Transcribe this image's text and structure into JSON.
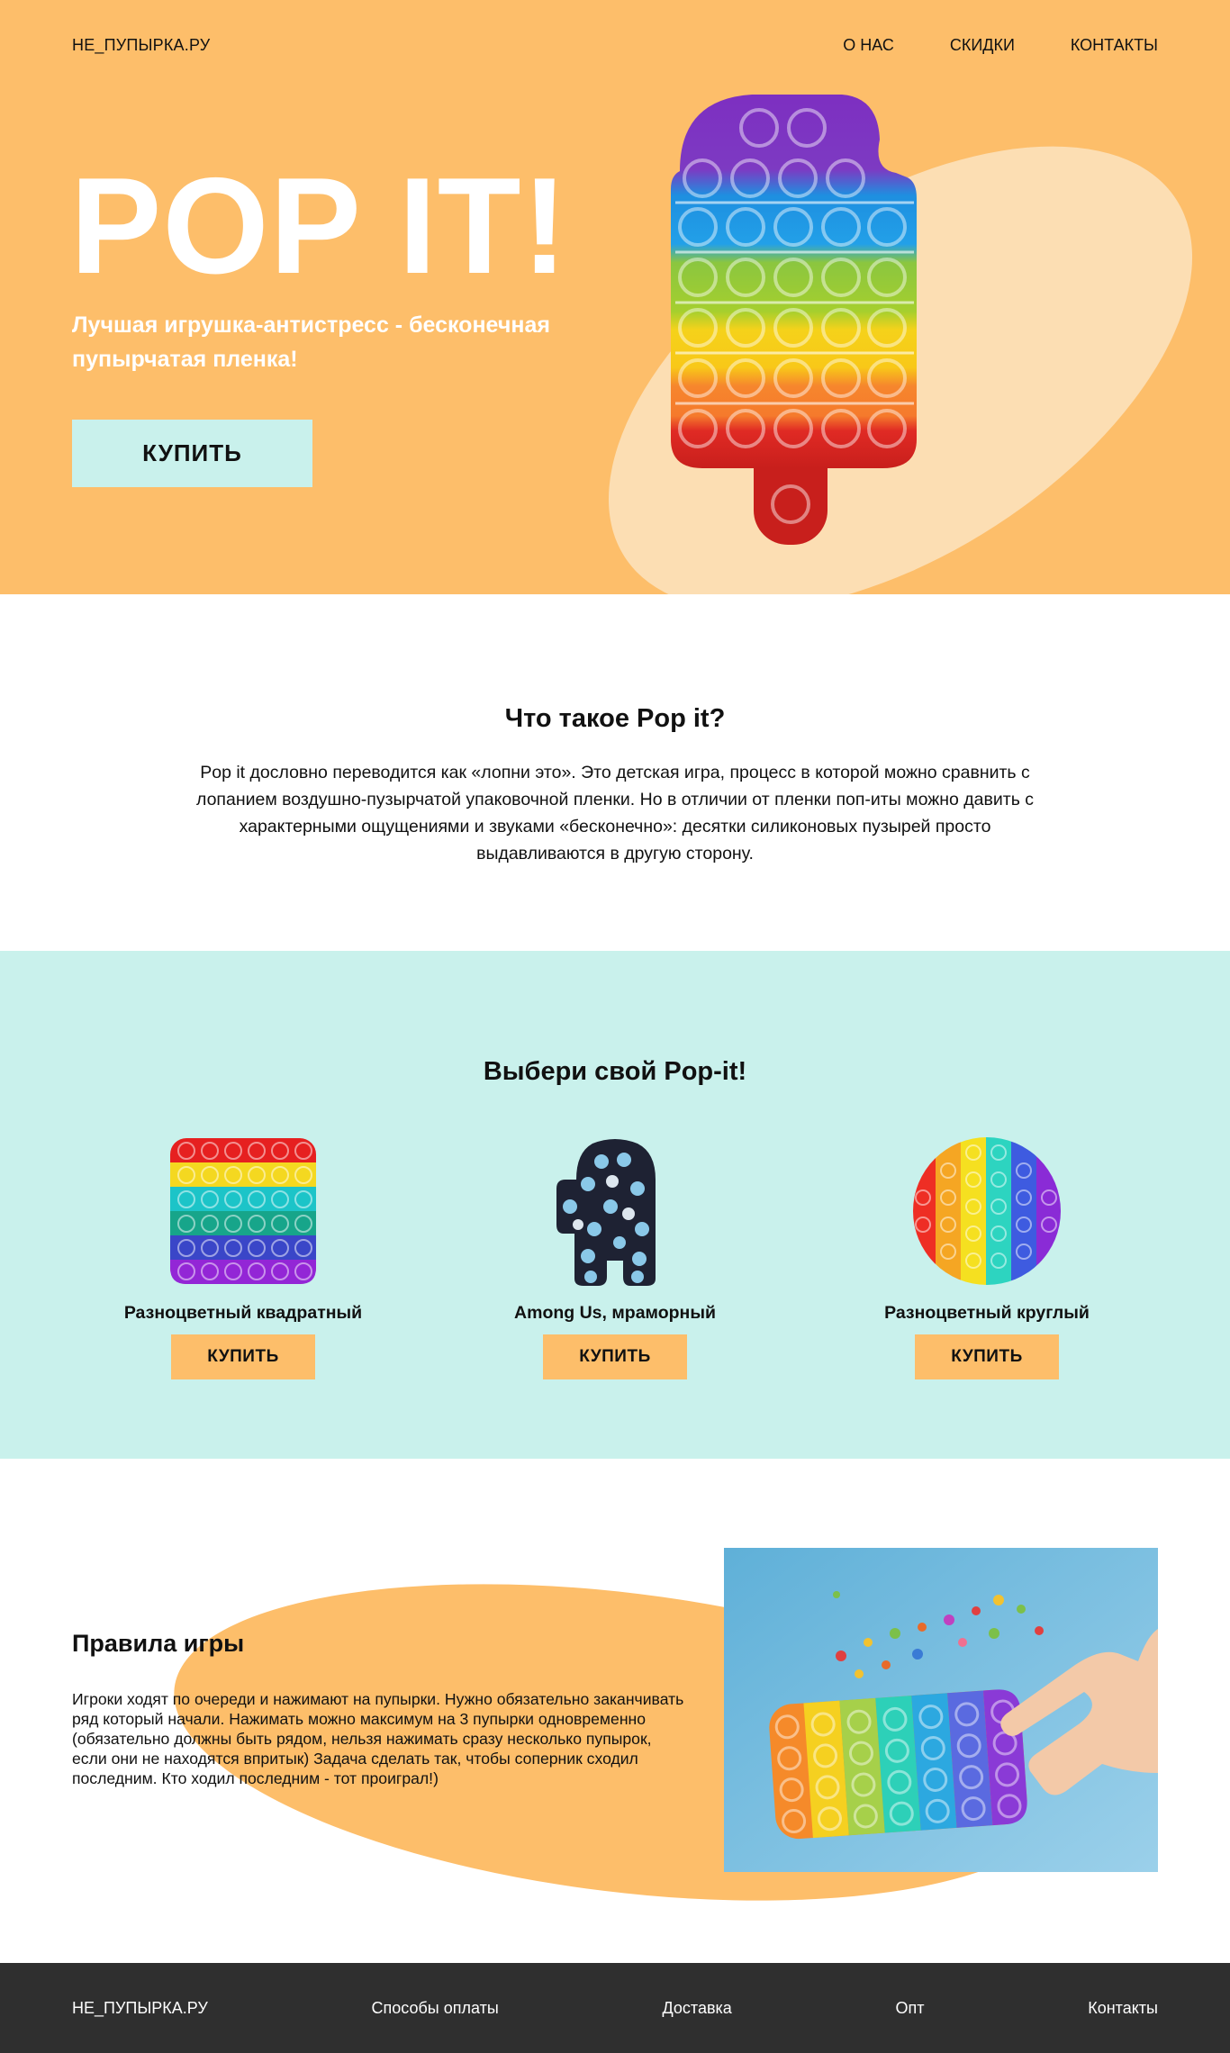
{
  "nav": {
    "logo": "НЕ_ПУПЫРКА.РУ",
    "links": [
      "О НАС",
      "СКИДКИ",
      "КОНТАКТЫ"
    ]
  },
  "hero": {
    "title": "POP IT!",
    "subtitle": "Лучшая игрушка-антистресс - бесконечная пупырчатая пленка!",
    "buy_label": "КУПИТЬ"
  },
  "what": {
    "title": "Что такое Pop it?",
    "text": "Pop it дословно переводится как «лопни это». Это детская игра, процесс в которой можно сравнить с лопанием воздушно-пузырчатой упаковочной пленки. Но в отличии от пленки поп-иты можно давить с характерными ощущениями и звуками «бесконечно»: десятки силиконовых пузырей просто выдавливаются в другую сторону."
  },
  "choose": {
    "title": "Выбери свой Pop-it!",
    "products": [
      {
        "name": "Разноцветный квадратный",
        "buy_label": "КУПИТЬ"
      },
      {
        "name": "Among Us, мраморный",
        "buy_label": "КУПИТЬ"
      },
      {
        "name": "Разноцветный круглый",
        "buy_label": "КУПИТЬ"
      }
    ]
  },
  "rules": {
    "title": "Правила игры",
    "text": "Игроки ходят по очереди и нажимают на пупырки. Нужно обязательно заканчивать ряд который начали. Нажимать можно максимум на 3 пупырки одновременно (обязательно должны быть рядом, нельзя нажимать сразу несколько пупырок, если они не находятся впритык) Задача сделать так, чтобы соперник сходил последним. Кто ходил последним - тот проиграл!)"
  },
  "footer": {
    "logo": "НЕ_ПУПЫРКА.РУ",
    "links": [
      "Способы оплаты",
      "Доставка",
      "Опт",
      "Контакты"
    ]
  },
  "colors": {
    "hero_bg": "#FDBE6A",
    "mint": "#C9F1EC",
    "footer_bg": "#2F2F2F"
  }
}
